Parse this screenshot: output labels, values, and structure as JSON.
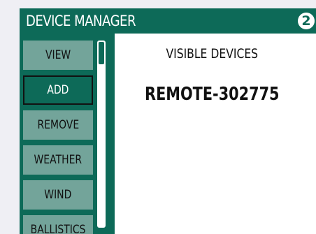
{
  "header": {
    "title": "DEVICE MANAGER",
    "badge": "2"
  },
  "sidebar": {
    "items": [
      {
        "label": "VIEW",
        "active": false
      },
      {
        "label": "ADD",
        "active": true
      },
      {
        "label": "REMOVE",
        "active": false
      },
      {
        "label": "WEATHER",
        "active": false
      },
      {
        "label": "WIND",
        "active": false
      },
      {
        "label": "BALLISTICS",
        "active": false
      }
    ]
  },
  "content": {
    "heading": "VISIBLE DEVICES",
    "devices": [
      "REMOTE-302775"
    ]
  },
  "colors": {
    "primary": "#0d6a58",
    "menu_item": "#73a49a",
    "background": "#efeff4",
    "panel": "#ffffff",
    "text": "#111111"
  }
}
